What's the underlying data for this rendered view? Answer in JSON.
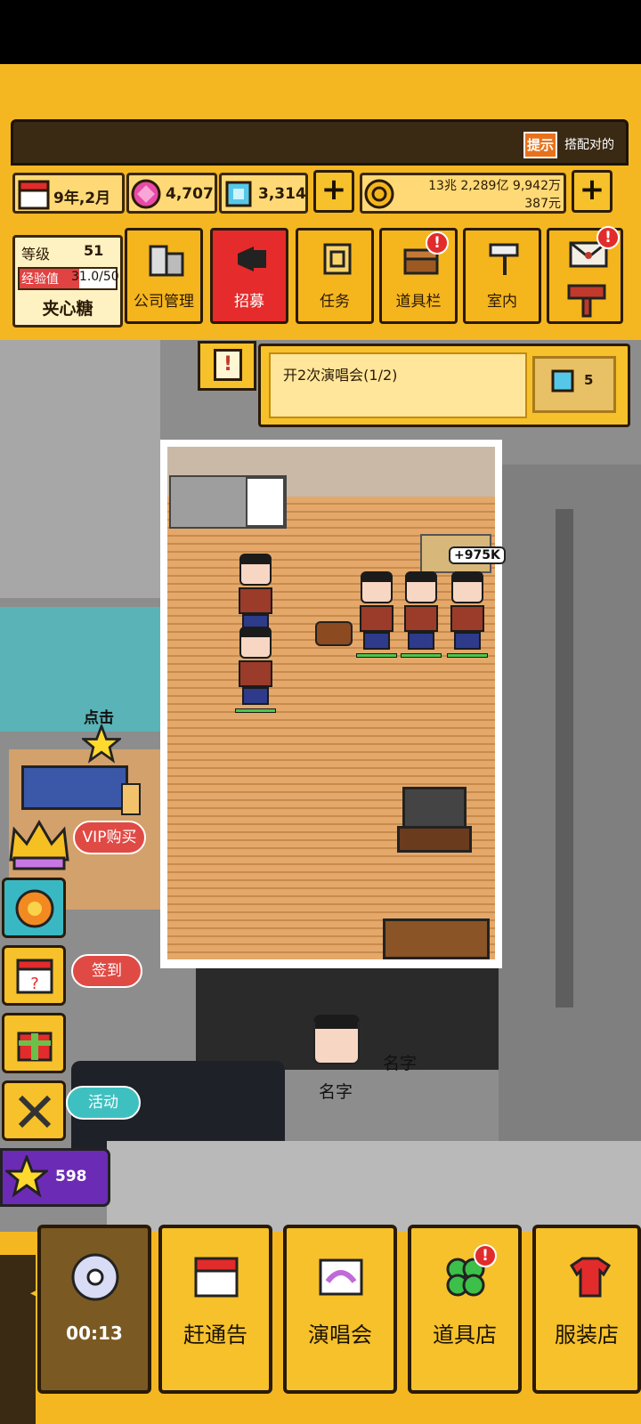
{
  "hud": {
    "hint_icon_text": "提示",
    "ticker_text": "搭配对的",
    "date": "9年,2月",
    "pink_gems": "4,707",
    "blue_gems": "3,314",
    "money_line1": "13兆 2,289亿 9,942万",
    "money_line2": "387元"
  },
  "level_panel": {
    "level_label": "等级",
    "level_value": "51",
    "exp_label": "经验值",
    "exp_value": "31.0/50",
    "exp_fraction": 0.62,
    "player_name": "夹心糖"
  },
  "menu": {
    "company": "公司管理",
    "recruit": "招募",
    "tasks": "任务",
    "inventory": "道具栏",
    "interior": "室内"
  },
  "quest": {
    "text": "开2次演唱会(1/2)",
    "reward": "5"
  },
  "scene": {
    "income_popup": "+975K",
    "tap_hint": "点击",
    "vip_label": "VIP购买",
    "checkin_label": "签到",
    "event_label": "活动",
    "stars_count": "598",
    "name_tag_1": "名字",
    "name_tag_2": "名字"
  },
  "nav": {
    "timer": "00:13",
    "schedule": "赶通告",
    "concert": "演唱会",
    "item_shop": "道具店",
    "clothing_shop": "服装店"
  },
  "colors": {
    "frame_yellow": "#f4b722",
    "recruit_red": "#e52b2b",
    "alert_red": "#e22b2b",
    "floor_wood": "#e3a86a"
  }
}
